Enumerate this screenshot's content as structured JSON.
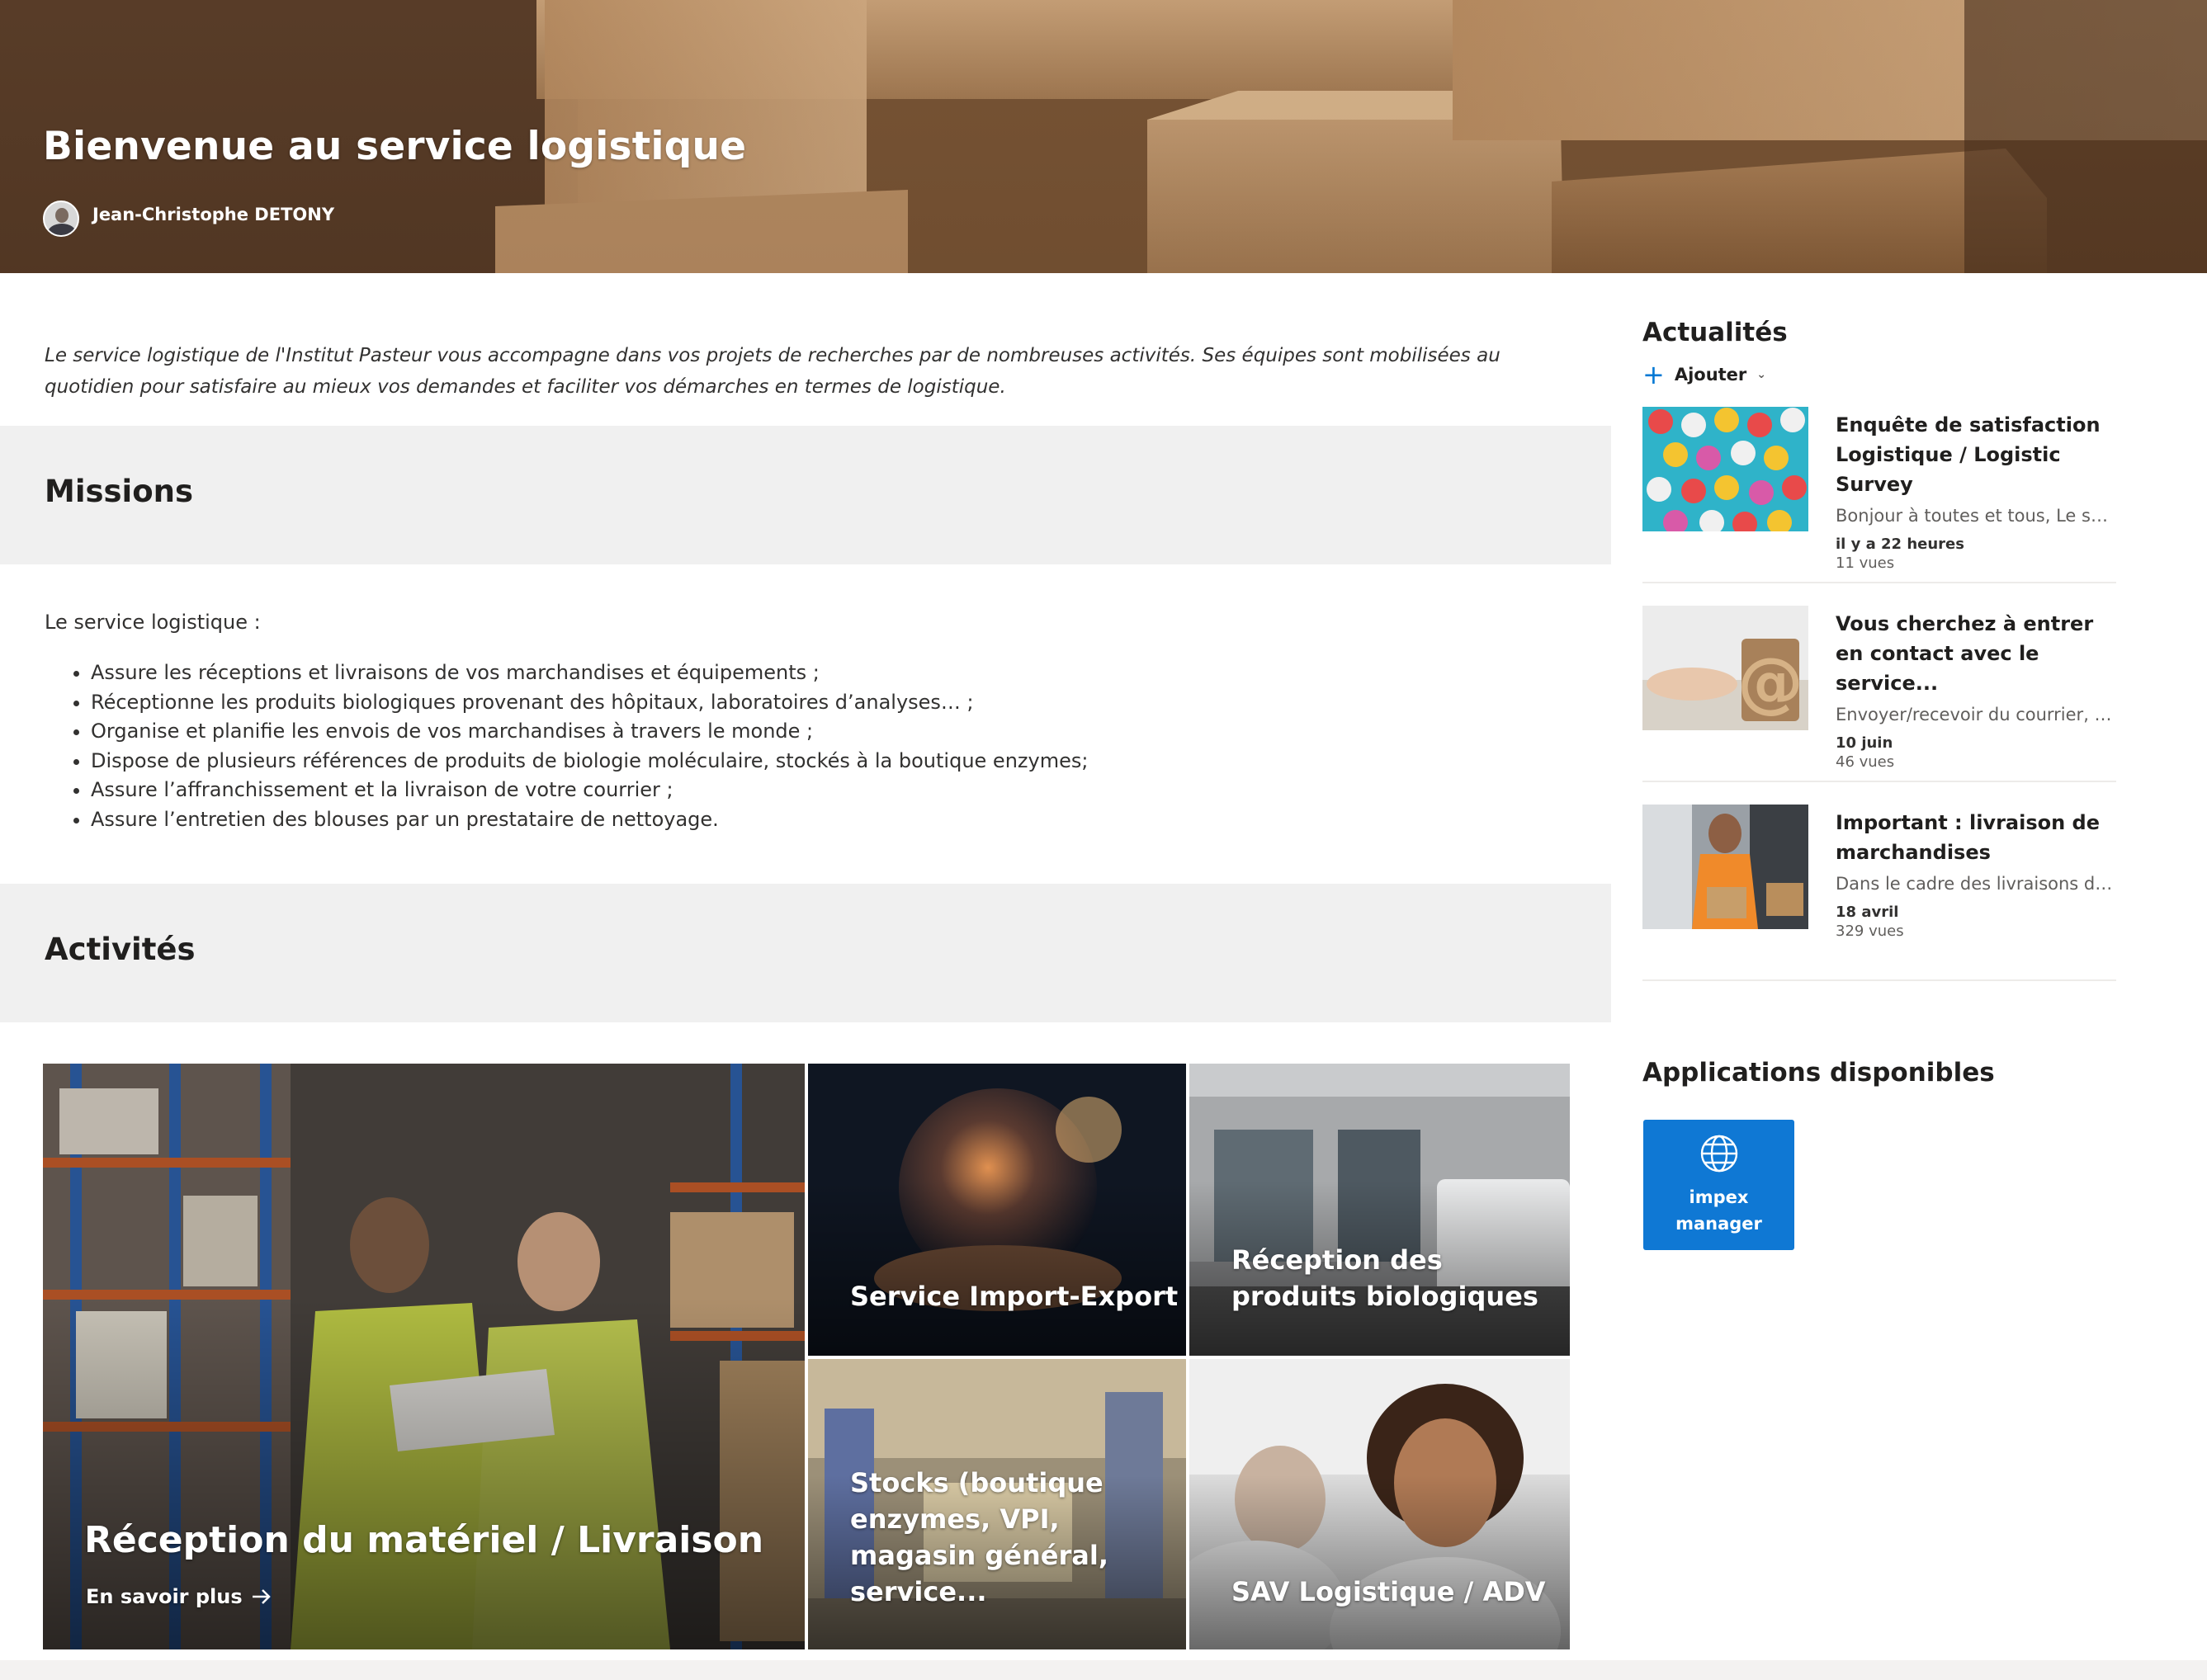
{
  "hero": {
    "title": "Bienvenue au service logistique",
    "author": "Jean-Christophe DETONY"
  },
  "intro": "Le service logistique de l'Institut Pasteur vous accompagne dans vos projets de recherches par de nombreuses activités. Ses équipes sont mobilisées au quotidien pour satisfaire au mieux vos demandes et faciliter vos démarches en termes de logistique.",
  "missions": {
    "heading": "Missions",
    "lead": "Le service logistique :",
    "items": [
      "Assure les réceptions et livraisons de vos marchandises et équipements ;",
      "Réceptionne les produits biologiques provenant des hôpitaux, laboratoires d’analyses… ;",
      "Organise et planifie les envois de vos marchandises à travers le monde ;",
      "Dispose de plusieurs références de produits de biologie moléculaire, stockés à la boutique enzymes;",
      "Assure l’affranchissement et la livraison de votre courrier ;",
      "Assure l’entretien des blouses par un prestataire de nettoyage."
    ]
  },
  "activities": {
    "heading": "Activités",
    "tiles": [
      {
        "title": "Réception du matériel / Livraison",
        "link": "En savoir plus"
      },
      {
        "title": "Service Import-Export"
      },
      {
        "title": "Réception des produits biologiques"
      },
      {
        "title": "Stocks (boutique enzymes, VPI, magasin général, service..."
      },
      {
        "title": "SAV Logistique / ADV"
      }
    ]
  },
  "news": {
    "heading": "Actualités",
    "add_label": "Ajouter",
    "items": [
      {
        "title": "Enquête de satisfaction Logistique / Logistic Survey",
        "desc": "Bonjour à toutes et tous, Le servi...",
        "date": "il y a 22 heures",
        "views": "11 vues"
      },
      {
        "title": "Vous cherchez à entrer en contact avec le service...",
        "desc": "Envoyer/recevoir du courrier, vou...",
        "date": "10 juin",
        "views": "46 vues"
      },
      {
        "title": "Important : livraison de marchandises",
        "desc": "Dans le cadre des livraisons de...",
        "date": "18 avril",
        "views": "329 vues"
      }
    ]
  },
  "apps": {
    "heading": "Applications disponibles",
    "items": [
      {
        "label": "impex manager",
        "icon": "globe-icon"
      }
    ]
  },
  "colors": {
    "accent": "#0078d4",
    "app_tile": "#0f78d4",
    "band": "#f0f0f0"
  }
}
